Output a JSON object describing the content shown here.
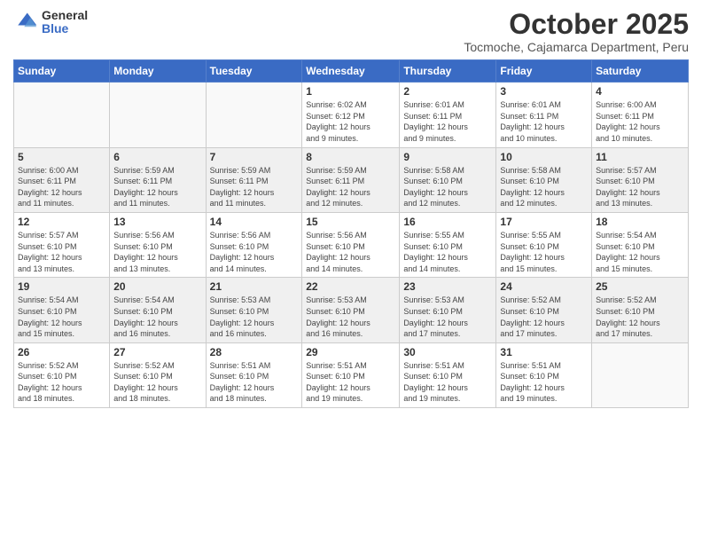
{
  "logo": {
    "general": "General",
    "blue": "Blue"
  },
  "header": {
    "month": "October 2025",
    "location": "Tocmoche, Cajamarca Department, Peru"
  },
  "weekdays": [
    "Sunday",
    "Monday",
    "Tuesday",
    "Wednesday",
    "Thursday",
    "Friday",
    "Saturday"
  ],
  "weeks": [
    [
      {
        "day": "",
        "info": ""
      },
      {
        "day": "",
        "info": ""
      },
      {
        "day": "",
        "info": ""
      },
      {
        "day": "1",
        "info": "Sunrise: 6:02 AM\nSunset: 6:12 PM\nDaylight: 12 hours\nand 9 minutes."
      },
      {
        "day": "2",
        "info": "Sunrise: 6:01 AM\nSunset: 6:11 PM\nDaylight: 12 hours\nand 9 minutes."
      },
      {
        "day": "3",
        "info": "Sunrise: 6:01 AM\nSunset: 6:11 PM\nDaylight: 12 hours\nand 10 minutes."
      },
      {
        "day": "4",
        "info": "Sunrise: 6:00 AM\nSunset: 6:11 PM\nDaylight: 12 hours\nand 10 minutes."
      }
    ],
    [
      {
        "day": "5",
        "info": "Sunrise: 6:00 AM\nSunset: 6:11 PM\nDaylight: 12 hours\nand 11 minutes."
      },
      {
        "day": "6",
        "info": "Sunrise: 5:59 AM\nSunset: 6:11 PM\nDaylight: 12 hours\nand 11 minutes."
      },
      {
        "day": "7",
        "info": "Sunrise: 5:59 AM\nSunset: 6:11 PM\nDaylight: 12 hours\nand 11 minutes."
      },
      {
        "day": "8",
        "info": "Sunrise: 5:59 AM\nSunset: 6:11 PM\nDaylight: 12 hours\nand 12 minutes."
      },
      {
        "day": "9",
        "info": "Sunrise: 5:58 AM\nSunset: 6:10 PM\nDaylight: 12 hours\nand 12 minutes."
      },
      {
        "day": "10",
        "info": "Sunrise: 5:58 AM\nSunset: 6:10 PM\nDaylight: 12 hours\nand 12 minutes."
      },
      {
        "day": "11",
        "info": "Sunrise: 5:57 AM\nSunset: 6:10 PM\nDaylight: 12 hours\nand 13 minutes."
      }
    ],
    [
      {
        "day": "12",
        "info": "Sunrise: 5:57 AM\nSunset: 6:10 PM\nDaylight: 12 hours\nand 13 minutes."
      },
      {
        "day": "13",
        "info": "Sunrise: 5:56 AM\nSunset: 6:10 PM\nDaylight: 12 hours\nand 13 minutes."
      },
      {
        "day": "14",
        "info": "Sunrise: 5:56 AM\nSunset: 6:10 PM\nDaylight: 12 hours\nand 14 minutes."
      },
      {
        "day": "15",
        "info": "Sunrise: 5:56 AM\nSunset: 6:10 PM\nDaylight: 12 hours\nand 14 minutes."
      },
      {
        "day": "16",
        "info": "Sunrise: 5:55 AM\nSunset: 6:10 PM\nDaylight: 12 hours\nand 14 minutes."
      },
      {
        "day": "17",
        "info": "Sunrise: 5:55 AM\nSunset: 6:10 PM\nDaylight: 12 hours\nand 15 minutes."
      },
      {
        "day": "18",
        "info": "Sunrise: 5:54 AM\nSunset: 6:10 PM\nDaylight: 12 hours\nand 15 minutes."
      }
    ],
    [
      {
        "day": "19",
        "info": "Sunrise: 5:54 AM\nSunset: 6:10 PM\nDaylight: 12 hours\nand 15 minutes."
      },
      {
        "day": "20",
        "info": "Sunrise: 5:54 AM\nSunset: 6:10 PM\nDaylight: 12 hours\nand 16 minutes."
      },
      {
        "day": "21",
        "info": "Sunrise: 5:53 AM\nSunset: 6:10 PM\nDaylight: 12 hours\nand 16 minutes."
      },
      {
        "day": "22",
        "info": "Sunrise: 5:53 AM\nSunset: 6:10 PM\nDaylight: 12 hours\nand 16 minutes."
      },
      {
        "day": "23",
        "info": "Sunrise: 5:53 AM\nSunset: 6:10 PM\nDaylight: 12 hours\nand 17 minutes."
      },
      {
        "day": "24",
        "info": "Sunrise: 5:52 AM\nSunset: 6:10 PM\nDaylight: 12 hours\nand 17 minutes."
      },
      {
        "day": "25",
        "info": "Sunrise: 5:52 AM\nSunset: 6:10 PM\nDaylight: 12 hours\nand 17 minutes."
      }
    ],
    [
      {
        "day": "26",
        "info": "Sunrise: 5:52 AM\nSunset: 6:10 PM\nDaylight: 12 hours\nand 18 minutes."
      },
      {
        "day": "27",
        "info": "Sunrise: 5:52 AM\nSunset: 6:10 PM\nDaylight: 12 hours\nand 18 minutes."
      },
      {
        "day": "28",
        "info": "Sunrise: 5:51 AM\nSunset: 6:10 PM\nDaylight: 12 hours\nand 18 minutes."
      },
      {
        "day": "29",
        "info": "Sunrise: 5:51 AM\nSunset: 6:10 PM\nDaylight: 12 hours\nand 19 minutes."
      },
      {
        "day": "30",
        "info": "Sunrise: 5:51 AM\nSunset: 6:10 PM\nDaylight: 12 hours\nand 19 minutes."
      },
      {
        "day": "31",
        "info": "Sunrise: 5:51 AM\nSunset: 6:10 PM\nDaylight: 12 hours\nand 19 minutes."
      },
      {
        "day": "",
        "info": ""
      }
    ]
  ]
}
